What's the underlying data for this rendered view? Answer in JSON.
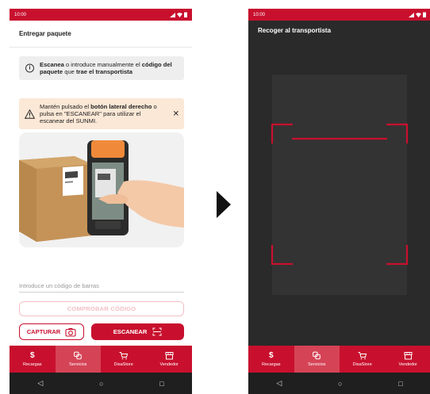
{
  "left_phone": {
    "status_time": "10:00",
    "title": "Entregar paquete",
    "info": {
      "bold1": "Escanea",
      "text1": " o introduce manualmente el ",
      "bold2": "código del paquete",
      "text2": " que ",
      "bold3": "trae el transportista"
    },
    "warning": {
      "text1": "Mantén pulsado el ",
      "bold1": "botón lateral derecho",
      "text2": " o pulsa en \"ESCANEAR\" para utilizar el escanear del SUNMI."
    },
    "barcode_placeholder": "Introduce un código de barras",
    "check_button": "COMPROBAR CÓDIGO",
    "capture_button": "CAPTURAR",
    "scan_button": "ESCANEAR"
  },
  "right_phone": {
    "status_time": "10:00",
    "title": "Recoger al transportista"
  },
  "nav": [
    {
      "label": "Recargas",
      "icon": "dollar-icon"
    },
    {
      "label": "Servicios",
      "icon": "services-icon"
    },
    {
      "label": "DisaStore",
      "icon": "cart-icon"
    },
    {
      "label": "Vendedor",
      "icon": "store-icon"
    }
  ],
  "colors": {
    "brand_red": "#c8102e",
    "warning_bg": "#fbe8d6",
    "info_bg": "#eeeeee",
    "scanner_bg": "#2a2a2a"
  }
}
